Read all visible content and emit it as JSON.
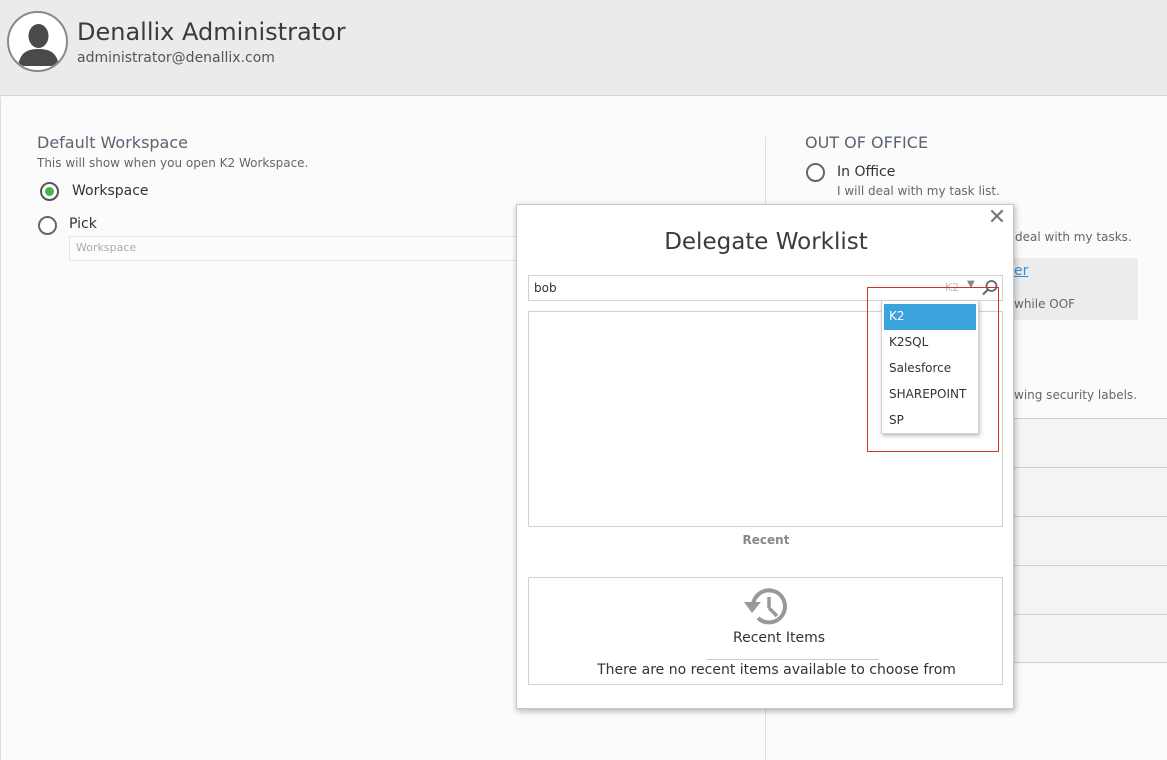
{
  "header": {
    "user_name": "Denallix Administrator",
    "user_email": "administrator@denallix.com"
  },
  "default_workspace": {
    "title": "Default Workspace",
    "subtitle": "This will show when you open K2 Workspace.",
    "options": [
      {
        "label": "Workspace",
        "selected": true
      },
      {
        "label": "Pick",
        "selected": false
      }
    ],
    "pick_placeholder": "Workspace"
  },
  "out_of_office": {
    "title": "OUT OF OFFICE",
    "in_office_label": "In Office",
    "in_office_desc": "I will deal with my task list.",
    "partial_desc_2": "deal with my tasks.",
    "partial_link": "er",
    "partial_oof": "while OOF",
    "partial_security": "wing security labels."
  },
  "modal": {
    "title": "Delegate Worklist",
    "search_value": "bob",
    "provider_selected": "K2",
    "recent_label": "Recent",
    "recent_title": "Recent Items",
    "recent_empty": "There are no recent items available to choose from"
  },
  "provider_dropdown": {
    "items": [
      "K2",
      "K2SQL",
      "Salesforce",
      "SHAREPOINT",
      "SP"
    ],
    "selected_index": 0
  },
  "colors": {
    "accent_blue": "#3aa3dd",
    "radio_green": "#4caf50",
    "highlight_red": "#d0312d"
  }
}
